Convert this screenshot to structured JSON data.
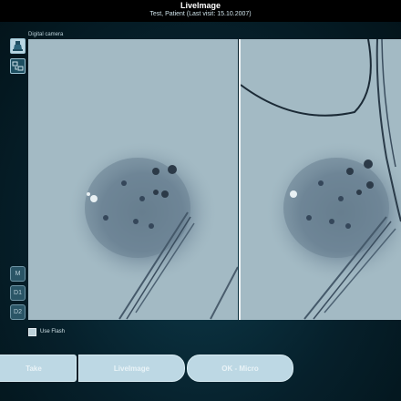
{
  "header": {
    "title": "LiveImage",
    "subtitle": "Test, Patient (Last visit: 15.10.2007)"
  },
  "panel": {
    "label": "Digital camera"
  },
  "sidebar": {
    "tools": [
      {
        "icon": "dermatoscope-icon",
        "active": true
      },
      {
        "icon": "compare-icon",
        "active": false
      }
    ],
    "modes": [
      {
        "label": "M"
      },
      {
        "label": "D1"
      },
      {
        "label": "D2"
      }
    ]
  },
  "options": {
    "flash_label": "Use Flash",
    "flash_checked": false
  },
  "actions": {
    "take_label": "Take",
    "liveimage_label": "LiveImage",
    "ok_label": "OK - Micro"
  },
  "colors": {
    "header_bg": "#000000",
    "background": "#0b3342",
    "button": "#bdd8e4",
    "skin": "#9fb6c0"
  }
}
